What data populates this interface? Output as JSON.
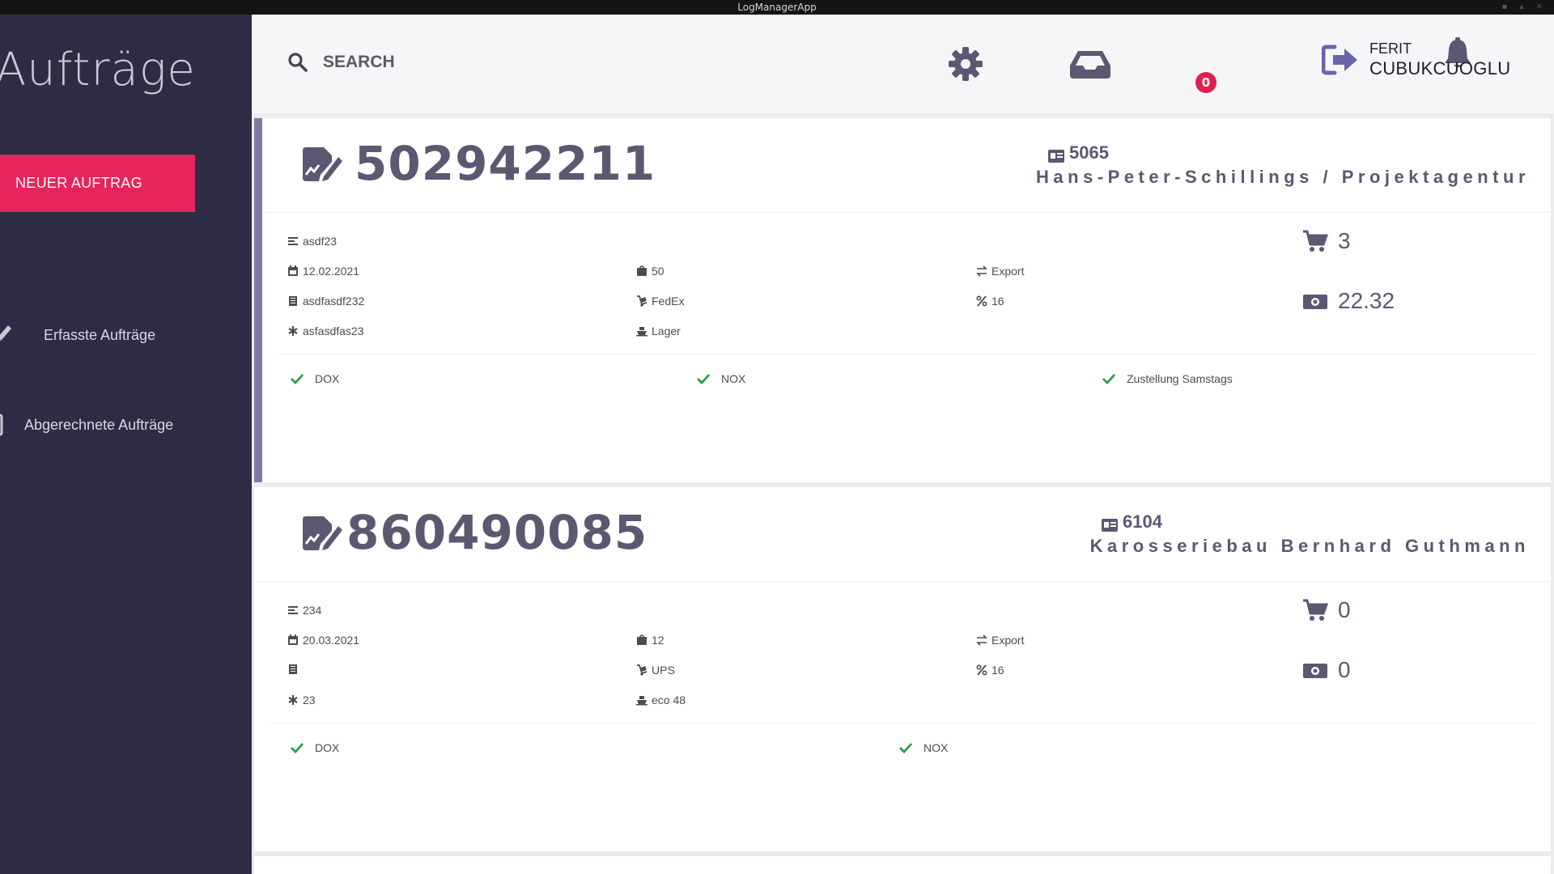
{
  "window": {
    "title": "LogManagerApp"
  },
  "sidebar": {
    "title": "Aufträge",
    "new_order_label": "NEUER AUFTRAG",
    "items": [
      {
        "label": "Erfasste Aufträge",
        "icon": "pencil-icon"
      },
      {
        "label": "Abgerechnete Aufträge",
        "icon": "document-icon"
      }
    ]
  },
  "header": {
    "search_placeholder": "SEARCH",
    "notification_count": "0",
    "user_first": "FERIT",
    "user_last": "CUBUKCUOGLU"
  },
  "colors": {
    "sidebar": "#2e2c44",
    "accent": "#e8245c",
    "text_primary": "#5b5871",
    "check": "#2e9c4a",
    "badge": "#e01e4f"
  },
  "orders": [
    {
      "order_number": "502942211",
      "customer_id": "5065",
      "customer_name": "Hans-Peter-Schillings / Projektagentur",
      "reference": "asdf23",
      "date": "12.02.2021",
      "code": "asdfasdf232",
      "misc": "asfasdfas23",
      "weight": "50",
      "carrier": "FedEx",
      "location": "Lager",
      "type": "Export",
      "tax": "16",
      "cart_count": "3",
      "amount": "22.32",
      "flags": [
        "DOX",
        "NOX",
        "Zustellung Samstags"
      ]
    },
    {
      "order_number": "860490085",
      "customer_id": "6104",
      "customer_name": "Karosseriebau Bernhard Guthmann",
      "reference": "234",
      "date": "20.03.2021",
      "code": "",
      "misc": "23",
      "weight": "12",
      "carrier": "UPS",
      "location": "eco 48",
      "type": "Export",
      "tax": "16",
      "cart_count": "0",
      "amount": "0",
      "flags": [
        "DOX",
        "NOX"
      ]
    }
  ]
}
